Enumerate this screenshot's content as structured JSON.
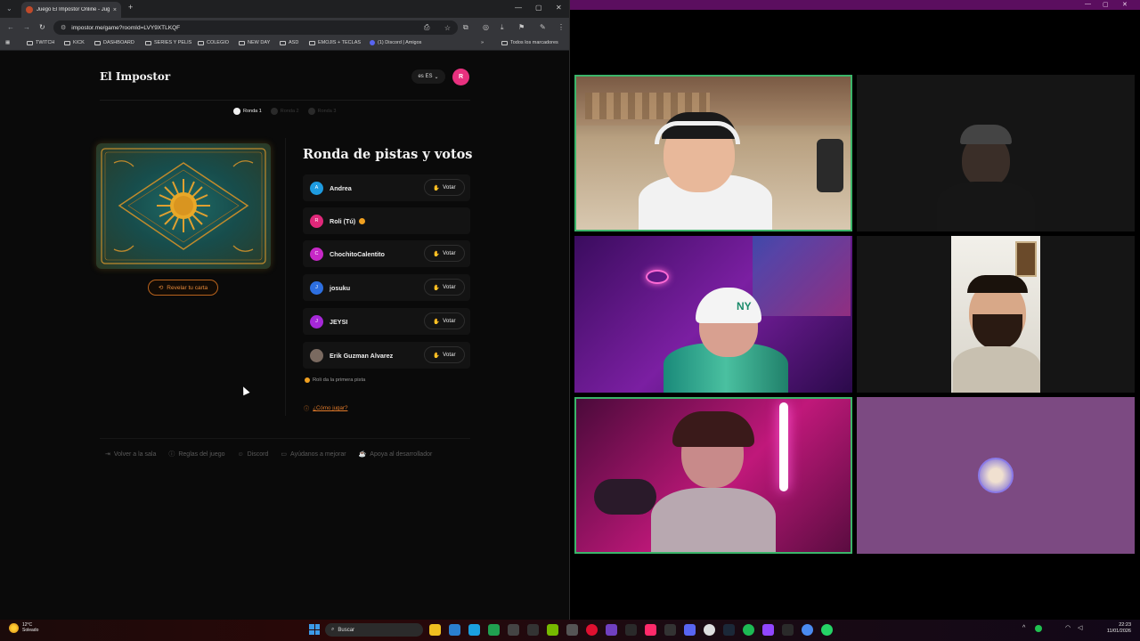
{
  "browser": {
    "tab_title": "Juego El Impostor Online - Jug",
    "new_tab": "+",
    "url": "impostor.me/game?roomId=LVY9XTLKQF",
    "bookmarks": [
      "TWITCH",
      "KICK",
      "DASHBOARD",
      "SERIES Y PELIS",
      "COLEGIO",
      "NEW DAY",
      "ASD",
      "EMOJIS + TECLAS",
      "(1) Discord | Amigos"
    ],
    "all_bookmarks": "Todos los marcadores"
  },
  "game": {
    "brand": "El Impostor",
    "language": "es ES",
    "user_initial": "R",
    "rounds": [
      {
        "label": "Ronda 1",
        "active": true
      },
      {
        "label": "Ronda 2",
        "active": false
      },
      {
        "label": "Ronda 3",
        "active": false
      }
    ],
    "reveal_label": "Revelar tu carta",
    "section_title": "Ronda de pistas y votos",
    "players": [
      {
        "initial": "A",
        "name": "Andrea",
        "color": "#1e9be0",
        "vote": "Votar"
      },
      {
        "initial": "R",
        "name": "Roli (Tú)",
        "color": "#e0287a",
        "vote": ""
      },
      {
        "initial": "C",
        "name": "ChochitoCalentito",
        "color": "#c728c7",
        "vote": "Votar"
      },
      {
        "initial": "J",
        "name": "josuku",
        "color": "#2d6fe0",
        "vote": "Votar"
      },
      {
        "initial": "J",
        "name": "JEYSI",
        "color": "#a628d8",
        "vote": "Votar"
      },
      {
        "initial": "",
        "name": "Erik Guzman Alvarez",
        "color": "#7a6a60",
        "vote": "Votar"
      }
    ],
    "hint": "Roli da la primera pista",
    "how_to_play": "¿Cómo jugar?",
    "footer": [
      "Volver a la sala",
      "Reglas del juego",
      "Discord",
      "Ayúdanos a mejorar",
      "Apoya al desarrollador"
    ]
  },
  "taskbar": {
    "weather_temp": "12°C",
    "weather_desc": "Soleado",
    "search_placeholder": "Buscar",
    "time": "22:23",
    "date": "11/01/2026"
  }
}
